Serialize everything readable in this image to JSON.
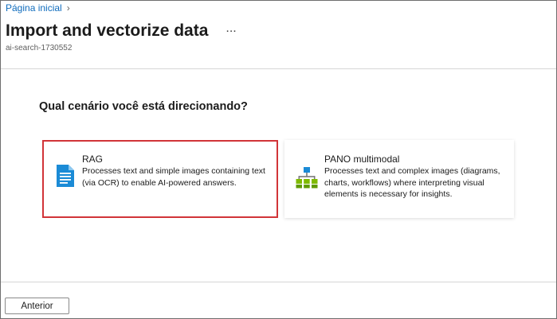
{
  "breadcrumb": {
    "home_label": "Página inicial"
  },
  "header": {
    "title": "Import and vectorize data",
    "more_label": "...",
    "subtitle": "ai-search-1730552"
  },
  "main": {
    "question": "Qual cenário você está direcionando?",
    "cards": [
      {
        "title": "RAG",
        "description": "Processes text and simple images containing text (via OCR) to enable AI-powered answers.",
        "icon": "document-icon",
        "selected": true
      },
      {
        "title": "PANO multimodal",
        "description": "Processes text and complex images (diagrams, charts, workflows) where interpreting visual elements is necessary for insights.",
        "icon": "hierarchy-icon",
        "selected": false
      }
    ]
  },
  "footer": {
    "back_label": "Anterior"
  },
  "colors": {
    "link": "#0f6cbd",
    "selection_border": "#d13438",
    "icon_blue": "#1b8bd6",
    "icon_green": "#7fba00"
  }
}
